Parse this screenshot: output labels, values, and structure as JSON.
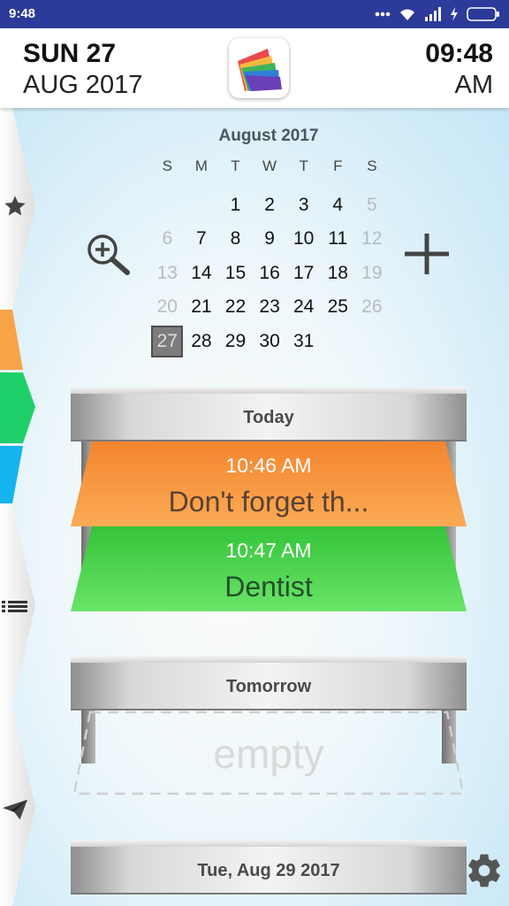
{
  "status_bar": {
    "time": "9:48",
    "icons": [
      "dots-icon",
      "wifi-icon",
      "signal-icon",
      "charging-icon",
      "battery-icon"
    ]
  },
  "header": {
    "day": "SUN 27",
    "month_year": "AUG 2017",
    "time": "09:48",
    "ampm": "AM",
    "logo": "app-logo"
  },
  "sidebar": {
    "tabs": [
      {
        "name": "favorites",
        "icon": "star-icon"
      },
      {
        "name": "category-orange",
        "color": "#f7a348"
      },
      {
        "name": "category-green",
        "color": "#1fcf6a"
      },
      {
        "name": "category-blue",
        "color": "#14b4ee"
      },
      {
        "name": "list",
        "icon": "list-icon"
      },
      {
        "name": "send",
        "icon": "paper-plane-icon"
      }
    ]
  },
  "calendar": {
    "title": "August 2017",
    "weekdays": [
      "S",
      "M",
      "T",
      "W",
      "T",
      "F",
      "S"
    ],
    "weeks": [
      [
        "",
        "",
        "1",
        "2",
        "3",
        "4",
        "5"
      ],
      [
        "6",
        "7",
        "8",
        "9",
        "10",
        "11",
        "12"
      ],
      [
        "13",
        "14",
        "15",
        "16",
        "17",
        "18",
        "19"
      ],
      [
        "20",
        "21",
        "22",
        "23",
        "24",
        "25",
        "26"
      ],
      [
        "27",
        "28",
        "29",
        "30",
        "31",
        "",
        ""
      ]
    ],
    "dim_days": [
      "5",
      "6",
      "12",
      "13",
      "19",
      "20",
      "26"
    ],
    "selected_day": "27",
    "zoom_icon": "zoom-in-icon",
    "add_icon": "plus-icon"
  },
  "shelves": [
    {
      "label": "Today",
      "events": [
        {
          "time": "10:46 AM",
          "title": "Don't forget th...",
          "color": "#f7923a"
        },
        {
          "time": "10:47 AM",
          "title": "Dentist",
          "color": "#4ed54a"
        }
      ]
    },
    {
      "label": "Tomorrow",
      "empty_text": "empty"
    },
    {
      "label": "Tue, Aug 29 2017"
    }
  ],
  "settings_icon": "gear-icon"
}
